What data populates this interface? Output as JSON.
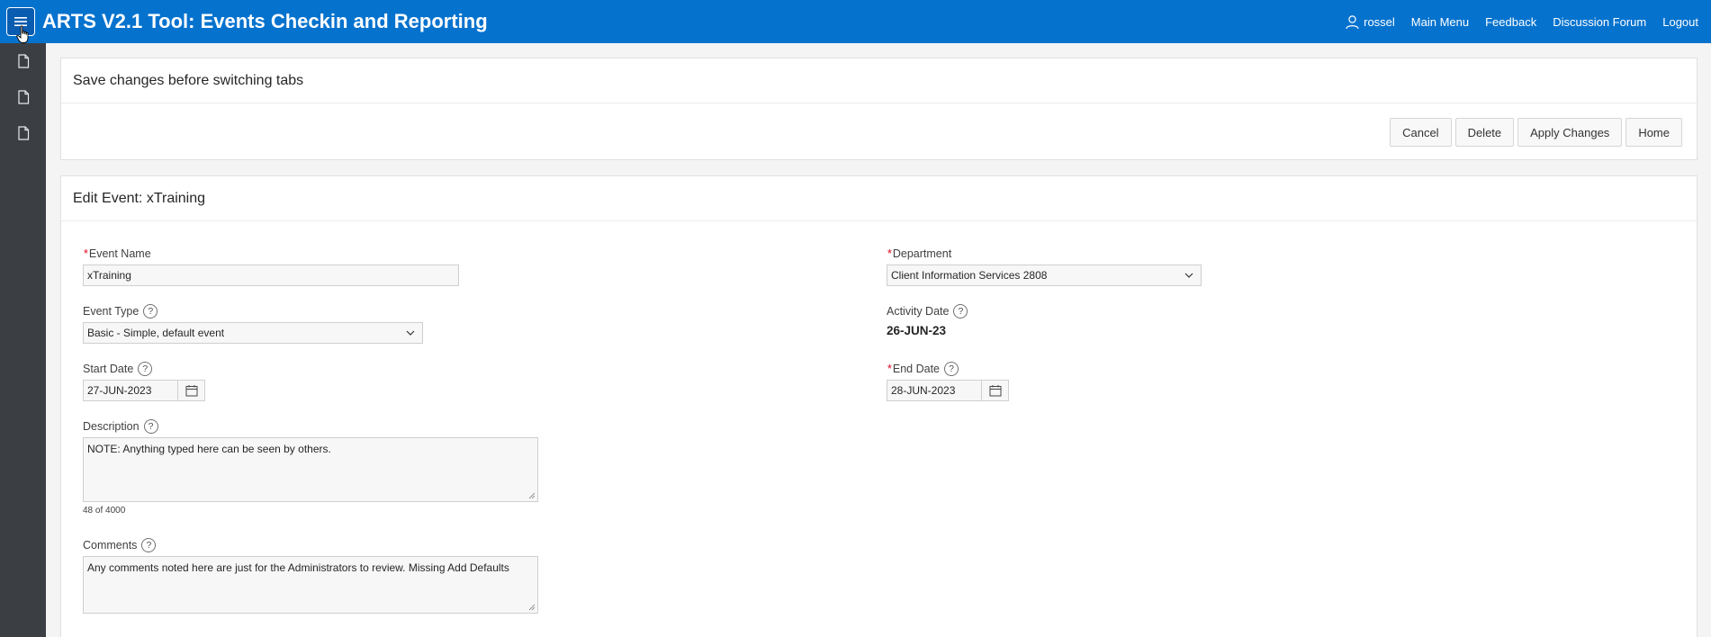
{
  "header": {
    "title": "ARTS V2.1 Tool: Events Checkin and Reporting",
    "username": "rossel",
    "links": [
      "Main Menu",
      "Feedback",
      "Discussion Forum",
      "Logout"
    ]
  },
  "region1": {
    "title": "Save changes before switching tabs",
    "buttons": {
      "cancel": "Cancel",
      "delete": "Delete",
      "apply": "Apply Changes",
      "home": "Home"
    }
  },
  "region2": {
    "title": "Edit Event: xTraining"
  },
  "form": {
    "event_name": {
      "label": "Event Name",
      "value": "xTraining",
      "required": "*"
    },
    "department": {
      "label": "Department",
      "value": "Client Information Services 2808",
      "required": "*"
    },
    "event_type": {
      "label": "Event Type",
      "value": "Basic - Simple, default event"
    },
    "activity_date": {
      "label": "Activity Date",
      "value": "26-JUN-23"
    },
    "start_date": {
      "label": "Start Date",
      "value": "27-JUN-2023"
    },
    "end_date": {
      "label": "End Date",
      "value": "28-JUN-2023",
      "required": "*"
    },
    "description": {
      "label": "Description",
      "value": "NOTE: Anything typed here can be seen by others.",
      "counter": "48 of 4000"
    },
    "comments": {
      "label": "Comments",
      "value": "Any comments noted here are just for the Administrators to review. Missing Add Defaults"
    },
    "help_glyph": "?"
  },
  "colors": {
    "header_bg": "#0572ce",
    "sidebar_bg": "#3b3f44",
    "required": "#e0001b"
  }
}
